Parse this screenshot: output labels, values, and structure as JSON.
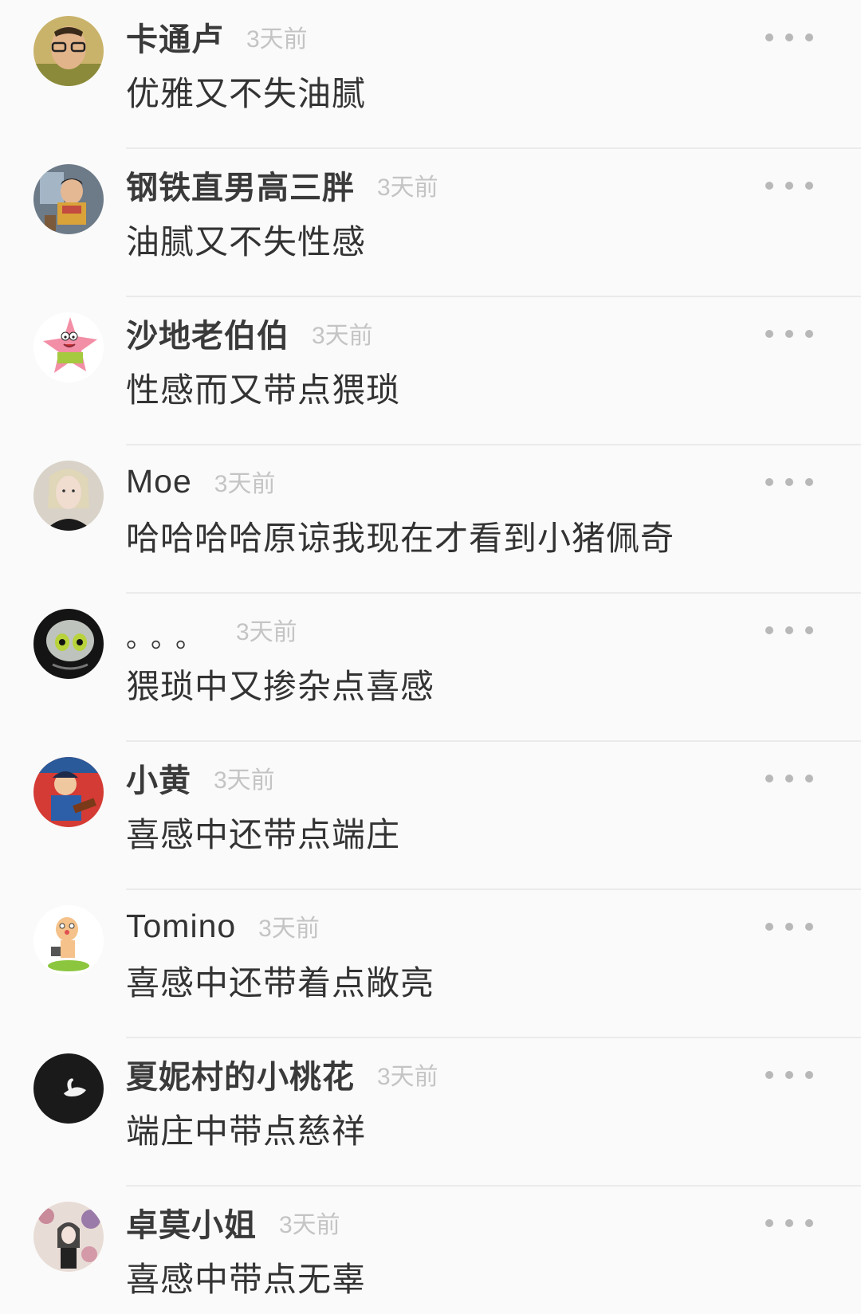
{
  "comments": [
    {
      "username": "卡通卢",
      "time": "3天前",
      "text": "优雅又不失油腻",
      "avatar_icon": "person-photo-avatar-icon"
    },
    {
      "username": "钢铁直男高三胖",
      "time": "3天前",
      "text": "油腻又不失性感",
      "avatar_icon": "child-photo-avatar-icon"
    },
    {
      "username": "沙地老伯伯",
      "time": "3天前",
      "text": "性感而又带点猥琐",
      "avatar_icon": "patrick-star-avatar-icon"
    },
    {
      "username": "Moe",
      "time": "3天前",
      "text": "哈哈哈哈原谅我现在才看到小猪佩奇",
      "avatar_icon": "woman-portrait-avatar-icon"
    },
    {
      "username": "。。。",
      "time": "3天前",
      "text": "猥琐中又掺杂点喜感",
      "avatar_icon": "cartoon-mask-avatar-icon"
    },
    {
      "username": "小黄",
      "time": "3天前",
      "text": "喜感中还带点端庄",
      "avatar_icon": "comic-illustration-avatar-icon"
    },
    {
      "username": "Tomino",
      "time": "3天前",
      "text": "喜感中还带着点敞亮",
      "avatar_icon": "cartoon-character-avatar-icon"
    },
    {
      "username": "夏妮村的小桃花",
      "time": "3天前",
      "text": "端庄中带点慈祥",
      "avatar_icon": "swan-avatar-icon"
    },
    {
      "username": "卓莫小姐",
      "time": "3天前",
      "text": "喜感中带点无辜",
      "avatar_icon": "girl-illustration-avatar-icon"
    }
  ],
  "more_icon": "more-dots-icon",
  "colors": {
    "background": "#fafafa",
    "divider": "#ebebeb",
    "username": "#3a3a3a",
    "time": "#c4c4c4",
    "comment": "#333333",
    "more_dots": "#b8b8b8"
  }
}
